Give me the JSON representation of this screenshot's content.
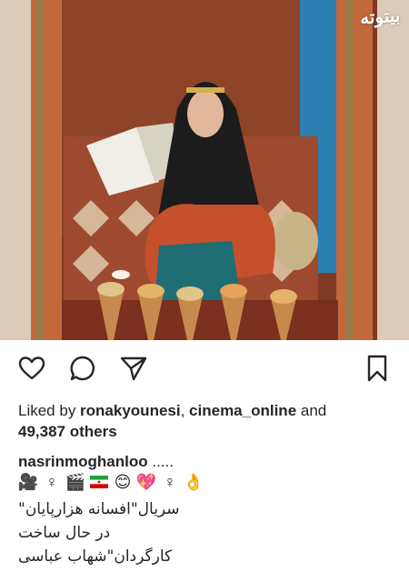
{
  "photo": {
    "watermark": "بیتوته",
    "alt": "Woman in black chador and orange dress sitting on a carpet-covered bench with food cones"
  },
  "actions": {
    "like_icon": "heart-icon",
    "comment_icon": "comment-icon",
    "share_icon": "paper-plane-icon",
    "save_icon": "bookmark-icon"
  },
  "likes": {
    "prefix": "Liked by ",
    "user1": "ronakyounesi",
    "separator": ", ",
    "user2": "cinema_online",
    "and": " and",
    "count": "49,387 others"
  },
  "caption": {
    "username": "nasrinmoghanloo",
    "text": " .....",
    "emojis": [
      "🎥",
      "♀",
      "🎬",
      "🇮🇷",
      "😊",
      "💖",
      "♀",
      "👌"
    ],
    "line1": "سریال\"افسانه هزارپایان\"",
    "line2": "در حال ساخت",
    "line3": "کارگردان\"شهاب عباسی"
  },
  "colors": {
    "text": "#262626",
    "photo_wall": "#8a3a22",
    "dress": "#c5502c",
    "chador": "#1c1c1c"
  }
}
